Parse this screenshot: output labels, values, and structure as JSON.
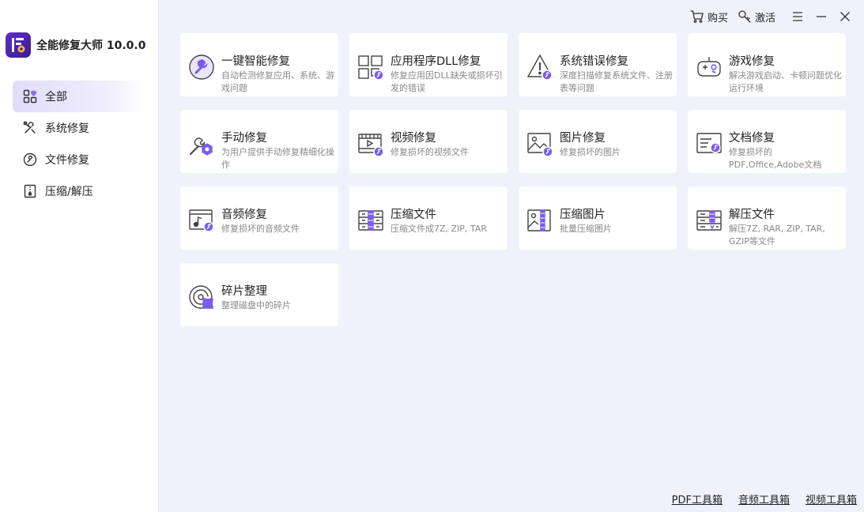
{
  "app": {
    "title": "全能修复大师 10.0.0"
  },
  "topbar": {
    "buy_label": "购买",
    "activate_label": "激活"
  },
  "sidebar": {
    "items": [
      {
        "label": "全部",
        "icon": "grid-icon"
      },
      {
        "label": "系统修复",
        "icon": "tools-icon"
      },
      {
        "label": "文件修复",
        "icon": "file-repair-icon"
      },
      {
        "label": "压缩/解压",
        "icon": "archive-icon"
      }
    ]
  },
  "cards": [
    {
      "title": "一键智能修复",
      "desc": "自动检测修复应用、系统、游戏问题",
      "icon": "wrench-circle-icon"
    },
    {
      "title": "应用程序DLL修复",
      "desc": "修复应用因DLL缺失或损坏引发的错误",
      "icon": "dll-icon"
    },
    {
      "title": "系统错误修复",
      "desc": "深度扫描修复系统文件、注册表等问题",
      "icon": "warning-icon"
    },
    {
      "title": "游戏修复",
      "desc": "解决游戏启动、卡顿问题优化运行环境",
      "icon": "gamepad-icon"
    },
    {
      "title": "手动修复",
      "desc": "为用户提供手动修复精细化操作",
      "icon": "wrench-gear-icon"
    },
    {
      "title": "视频修复",
      "desc": "修复损坏的视频文件",
      "icon": "video-icon"
    },
    {
      "title": "图片修复",
      "desc": "修复损坏的图片",
      "icon": "image-icon"
    },
    {
      "title": "文档修复",
      "desc": "修复损坏的PDF,Office,Adobe文档",
      "icon": "document-icon"
    },
    {
      "title": "音频修复",
      "desc": "修复损坏的音频文件",
      "icon": "audio-icon"
    },
    {
      "title": "压缩文件",
      "desc": "压缩文件成7Z, ZIP, TAR",
      "icon": "compress-file-icon"
    },
    {
      "title": "压缩图片",
      "desc": "批量压缩图片",
      "icon": "compress-image-icon"
    },
    {
      "title": "解压文件",
      "desc": "解压7Z, RAR, ZIP, TAR, GZIP等文件",
      "icon": "extract-icon"
    },
    {
      "title": "碎片整理",
      "desc": "整理磁盘中的碎片",
      "icon": "defrag-icon"
    }
  ],
  "footer": {
    "links": [
      "PDF工具箱",
      "音频工具箱",
      "视频工具箱"
    ]
  },
  "colors": {
    "accent": "#7a5cf0",
    "accent_dark": "#3a1b8f",
    "background": "#f0f2fb"
  }
}
